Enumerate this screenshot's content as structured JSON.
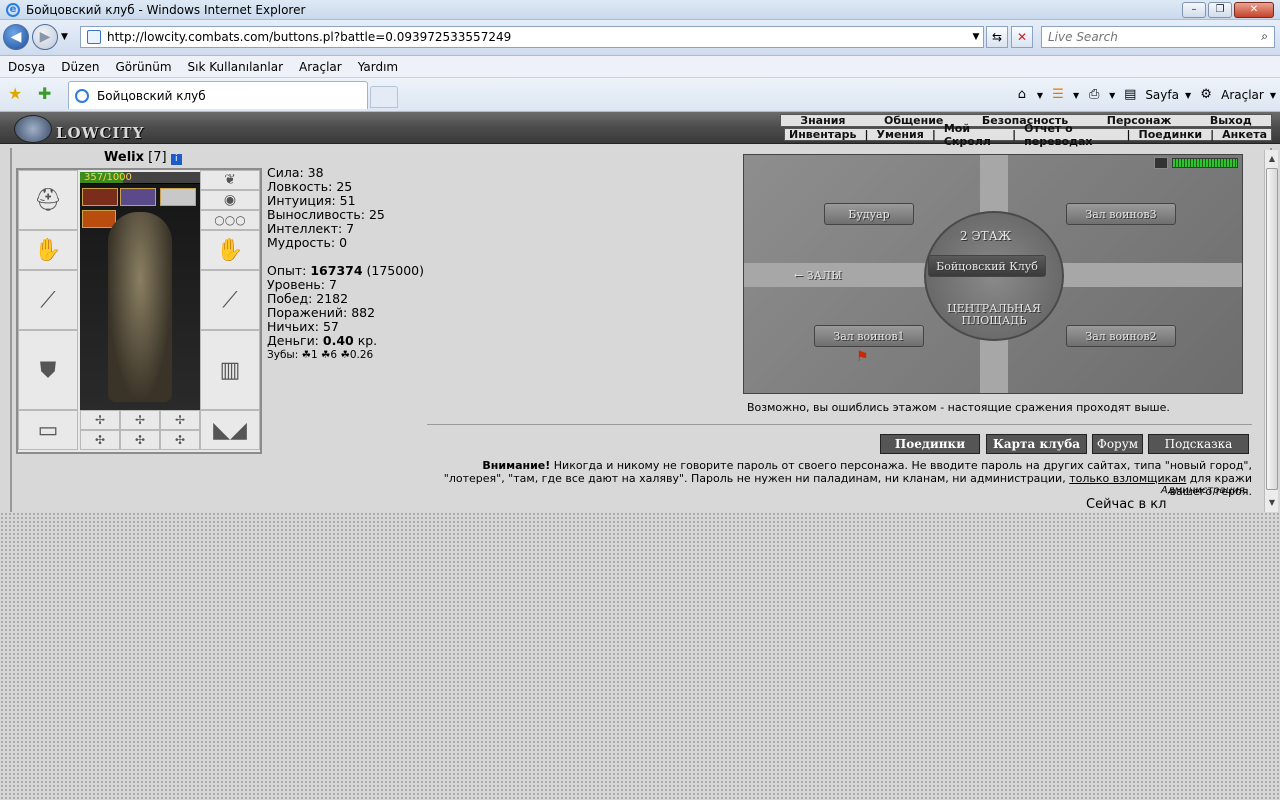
{
  "window": {
    "title": "Бойцовский клуб - Windows Internet Explorer"
  },
  "address": {
    "url": "http://lowcity.combats.com/buttons.pl?battle=0.093972533557249"
  },
  "search": {
    "placeholder": "Live Search"
  },
  "menu": [
    "Dosya",
    "Düzen",
    "Görünüm",
    "Sık Kullanılanlar",
    "Araçlar",
    "Yardım"
  ],
  "tab": {
    "title": "Бойцовский клуб"
  },
  "toolbar": {
    "page": "Sayfa",
    "tools": "Araçlar"
  },
  "game": {
    "logo_text": "LOWCITY",
    "top_menu": [
      "Знания",
      "Общение",
      "Безопасность",
      "Персонаж",
      "Выход"
    ],
    "sub_menu": [
      "Инвентарь",
      "|",
      "Умения",
      "|",
      "Мой Скролл",
      "|",
      "Отчет о переводах",
      "|",
      "Поединки",
      "|",
      "Анкета"
    ]
  },
  "character": {
    "name": "Welix",
    "level": "[7]",
    "hp_text": "357/1000",
    "hp_fraction": 0.357
  },
  "stats": {
    "strength": "Сила: 38",
    "agility": "Ловкость: 25",
    "intuition": "Интуиция: 51",
    "endurance": "Выносливость: 25",
    "intellect": "Интеллект: 7",
    "wisdom": "Мудрость: 0",
    "exp_label": "Опыт: ",
    "exp_value": "167374",
    "exp_next": " (175000)",
    "level": "Уровень: 7",
    "wins": "Побед: 2182",
    "losses": "Поражений: 882",
    "draws": "Ничьих: 57",
    "money_label": "Деньги: ",
    "money_value": "0.40",
    "money_unit": " кр.",
    "teeth": "Зубы: ☘1 ☘6 ☘0.26"
  },
  "map": {
    "boudoir": "Будуар",
    "hall3": "Зал воинов3",
    "floor": "2 ЭТАЖ",
    "club": "Бойцовский Клуб",
    "halls": "← ЗАЛЫ",
    "square": "ЦЕНТРАЛЬНАЯ ПЛОЩАДЬ",
    "hall1": "Зал воинов1",
    "hall2": "Зал воинов2",
    "note": "Возможно, вы ошиблись этажом - настоящие сражения проходят выше."
  },
  "buttons": {
    "fights": "Поединки",
    "map": "Карта клуба",
    "forum": "Форум",
    "hint": "Подсказка"
  },
  "warning": {
    "bold": "Внимание!",
    "text": " Никогда и никому не говорите пароль от своего персонажа. Не вводите пароль на других сайтах, типа \"новый город\", \"лотерея\", \"там, где все дают на халяву\". Пароль не нужен ни паладинам, ни кланам, ни администрации, ",
    "link": "только взломщикам",
    "tail": " для кражи вашего героя.",
    "admin": "Администрация."
  },
  "online": {
    "text": "Сейчас в кл"
  }
}
